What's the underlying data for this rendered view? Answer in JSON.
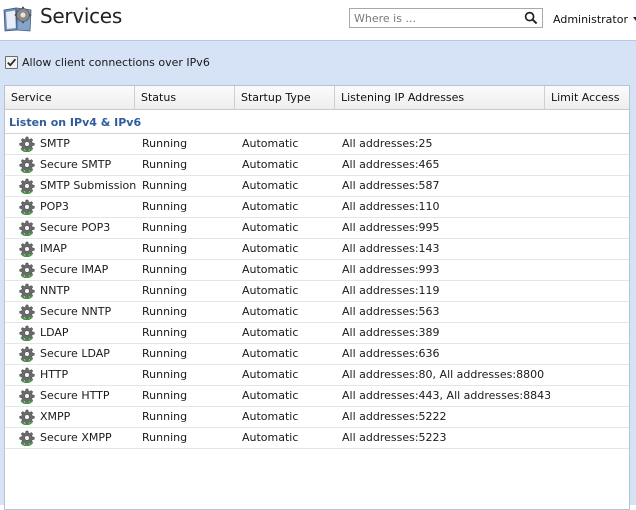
{
  "header": {
    "title": "Services",
    "search_placeholder": "Where is ...",
    "user_label": "Administrator",
    "app_icon": "services-book-gear-icon"
  },
  "options": {
    "ipv6_label": "Allow client connections over IPv6",
    "ipv6_checked": true
  },
  "table": {
    "columns": [
      "Service",
      "Status",
      "Startup Type",
      "Listening IP Addresses",
      "Limit Access"
    ],
    "group_label": "Listen on IPv4 & IPv6",
    "row_icon": "gear-icon",
    "rows": [
      {
        "service": "SMTP",
        "status": "Running",
        "startup": "Automatic",
        "listening": "All addresses:25",
        "limit": ""
      },
      {
        "service": "Secure SMTP",
        "status": "Running",
        "startup": "Automatic",
        "listening": "All addresses:465",
        "limit": ""
      },
      {
        "service": "SMTP Submission",
        "status": "Running",
        "startup": "Automatic",
        "listening": "All addresses:587",
        "limit": ""
      },
      {
        "service": "POP3",
        "status": "Running",
        "startup": "Automatic",
        "listening": "All addresses:110",
        "limit": ""
      },
      {
        "service": "Secure POP3",
        "status": "Running",
        "startup": "Automatic",
        "listening": "All addresses:995",
        "limit": ""
      },
      {
        "service": "IMAP",
        "status": "Running",
        "startup": "Automatic",
        "listening": "All addresses:143",
        "limit": ""
      },
      {
        "service": "Secure IMAP",
        "status": "Running",
        "startup": "Automatic",
        "listening": "All addresses:993",
        "limit": ""
      },
      {
        "service": "NNTP",
        "status": "Running",
        "startup": "Automatic",
        "listening": "All addresses:119",
        "limit": ""
      },
      {
        "service": "Secure NNTP",
        "status": "Running",
        "startup": "Automatic",
        "listening": "All addresses:563",
        "limit": ""
      },
      {
        "service": "LDAP",
        "status": "Running",
        "startup": "Automatic",
        "listening": "All addresses:389",
        "limit": ""
      },
      {
        "service": "Secure LDAP",
        "status": "Running",
        "startup": "Automatic",
        "listening": "All addresses:636",
        "limit": ""
      },
      {
        "service": "HTTP",
        "status": "Running",
        "startup": "Automatic",
        "listening": "All addresses:80, All addresses:8800",
        "limit": ""
      },
      {
        "service": "Secure HTTP",
        "status": "Running",
        "startup": "Automatic",
        "listening": "All addresses:443, All addresses:8843",
        "limit": ""
      },
      {
        "service": "XMPP",
        "status": "Running",
        "startup": "Automatic",
        "listening": "All addresses:5222",
        "limit": ""
      },
      {
        "service": "Secure XMPP",
        "status": "Running",
        "startup": "Automatic",
        "listening": "All addresses:5223",
        "limit": ""
      }
    ]
  },
  "colors": {
    "content_background": "#d6e2f5",
    "group_heading": "#2f5d9b"
  }
}
